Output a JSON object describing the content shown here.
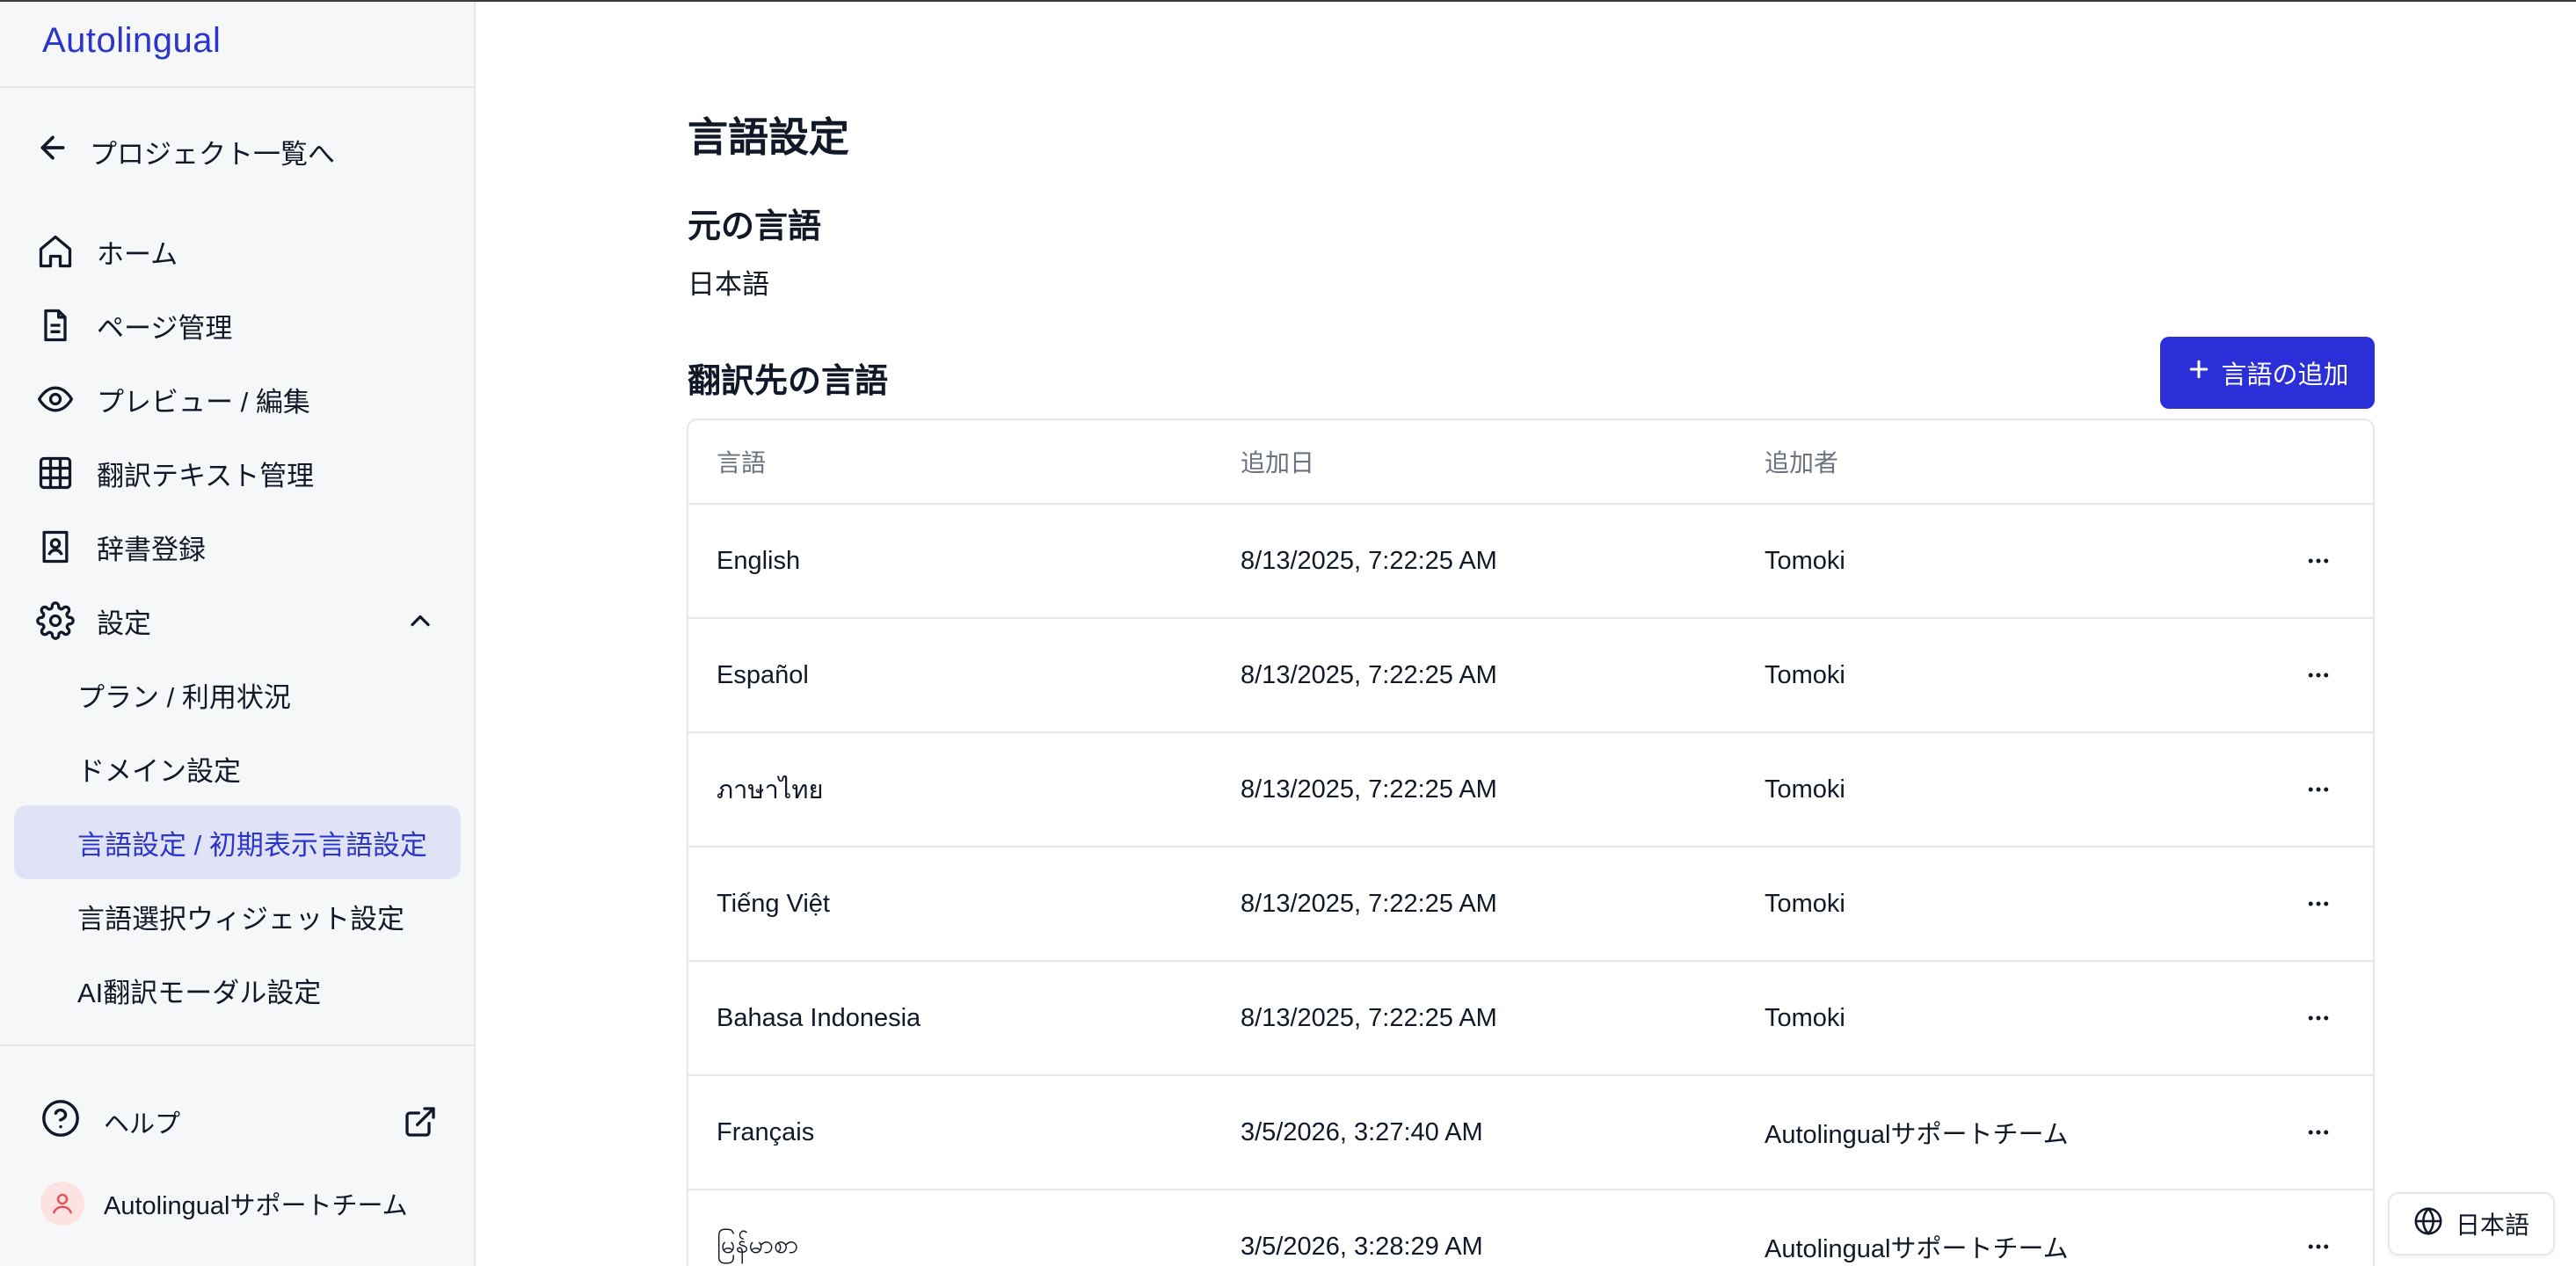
{
  "app": {
    "logo": "Autolingual"
  },
  "sidebar": {
    "back_label": "プロジェクト一覧へ",
    "items": [
      {
        "label": "ホーム",
        "icon": "home-icon"
      },
      {
        "label": "ページ管理",
        "icon": "document-icon"
      },
      {
        "label": "プレビュー / 編集",
        "icon": "eye-icon"
      },
      {
        "label": "翻訳テキスト管理",
        "icon": "table-icon"
      },
      {
        "label": "辞書登録",
        "icon": "dictionary-icon"
      },
      {
        "label": "設定",
        "icon": "gear-icon"
      }
    ],
    "sub_items": [
      {
        "label": "プラン / 利用状況"
      },
      {
        "label": "ドメイン設定"
      },
      {
        "label": "言語設定 / 初期表示言語設定"
      },
      {
        "label": "言語選択ウィジェット設定"
      },
      {
        "label": "AI翻訳モーダル設定"
      }
    ],
    "help_label": "ヘルプ",
    "user_name": "Autolingualサポートチーム"
  },
  "main": {
    "page_title": "言語設定",
    "source_section_title": "元の言語",
    "source_language": "日本語",
    "target_section_title": "翻訳先の言語",
    "add_button_label": "言語の追加",
    "table": {
      "headers": [
        "言語",
        "追加日",
        "追加者"
      ],
      "rows": [
        {
          "language": "English",
          "added": "8/13/2025, 7:22:25 AM",
          "by": "Tomoki"
        },
        {
          "language": "Español",
          "added": "8/13/2025, 7:22:25 AM",
          "by": "Tomoki"
        },
        {
          "language": "ภาษาไทย",
          "added": "8/13/2025, 7:22:25 AM",
          "by": "Tomoki"
        },
        {
          "language": "Tiếng Việt",
          "added": "8/13/2025, 7:22:25 AM",
          "by": "Tomoki"
        },
        {
          "language": "Bahasa Indonesia",
          "added": "8/13/2025, 7:22:25 AM",
          "by": "Tomoki"
        },
        {
          "language": "Français",
          "added": "3/5/2026, 3:27:40 AM",
          "by": "Autolingualサポートチーム"
        },
        {
          "language": "မြန်မာစာ",
          "added": "3/5/2026, 3:28:29 AM",
          "by": "Autolingualサポートチーム"
        }
      ]
    }
  },
  "language_switcher": {
    "label": "日本語"
  },
  "colors": {
    "accent": "#2b2fd8",
    "active_bg": "#e0e3f5",
    "brand": "#2b35c9"
  }
}
